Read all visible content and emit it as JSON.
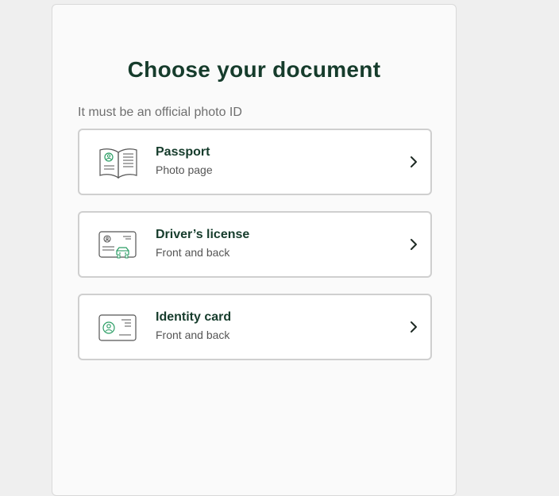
{
  "heading": "Choose your document",
  "subtitle": "It must be an official photo ID",
  "documents": [
    {
      "label": "Passport",
      "sublabel": "Photo page",
      "icon": "passport-icon"
    },
    {
      "label": "Driver’s license",
      "sublabel": "Front and back",
      "icon": "drivers-license-icon"
    },
    {
      "label": "Identity card",
      "sublabel": "Front and back",
      "icon": "identity-card-icon"
    }
  ],
  "colors": {
    "title": "#163c2c",
    "accent": "#2a9d64",
    "border": "#cfcfcf"
  }
}
